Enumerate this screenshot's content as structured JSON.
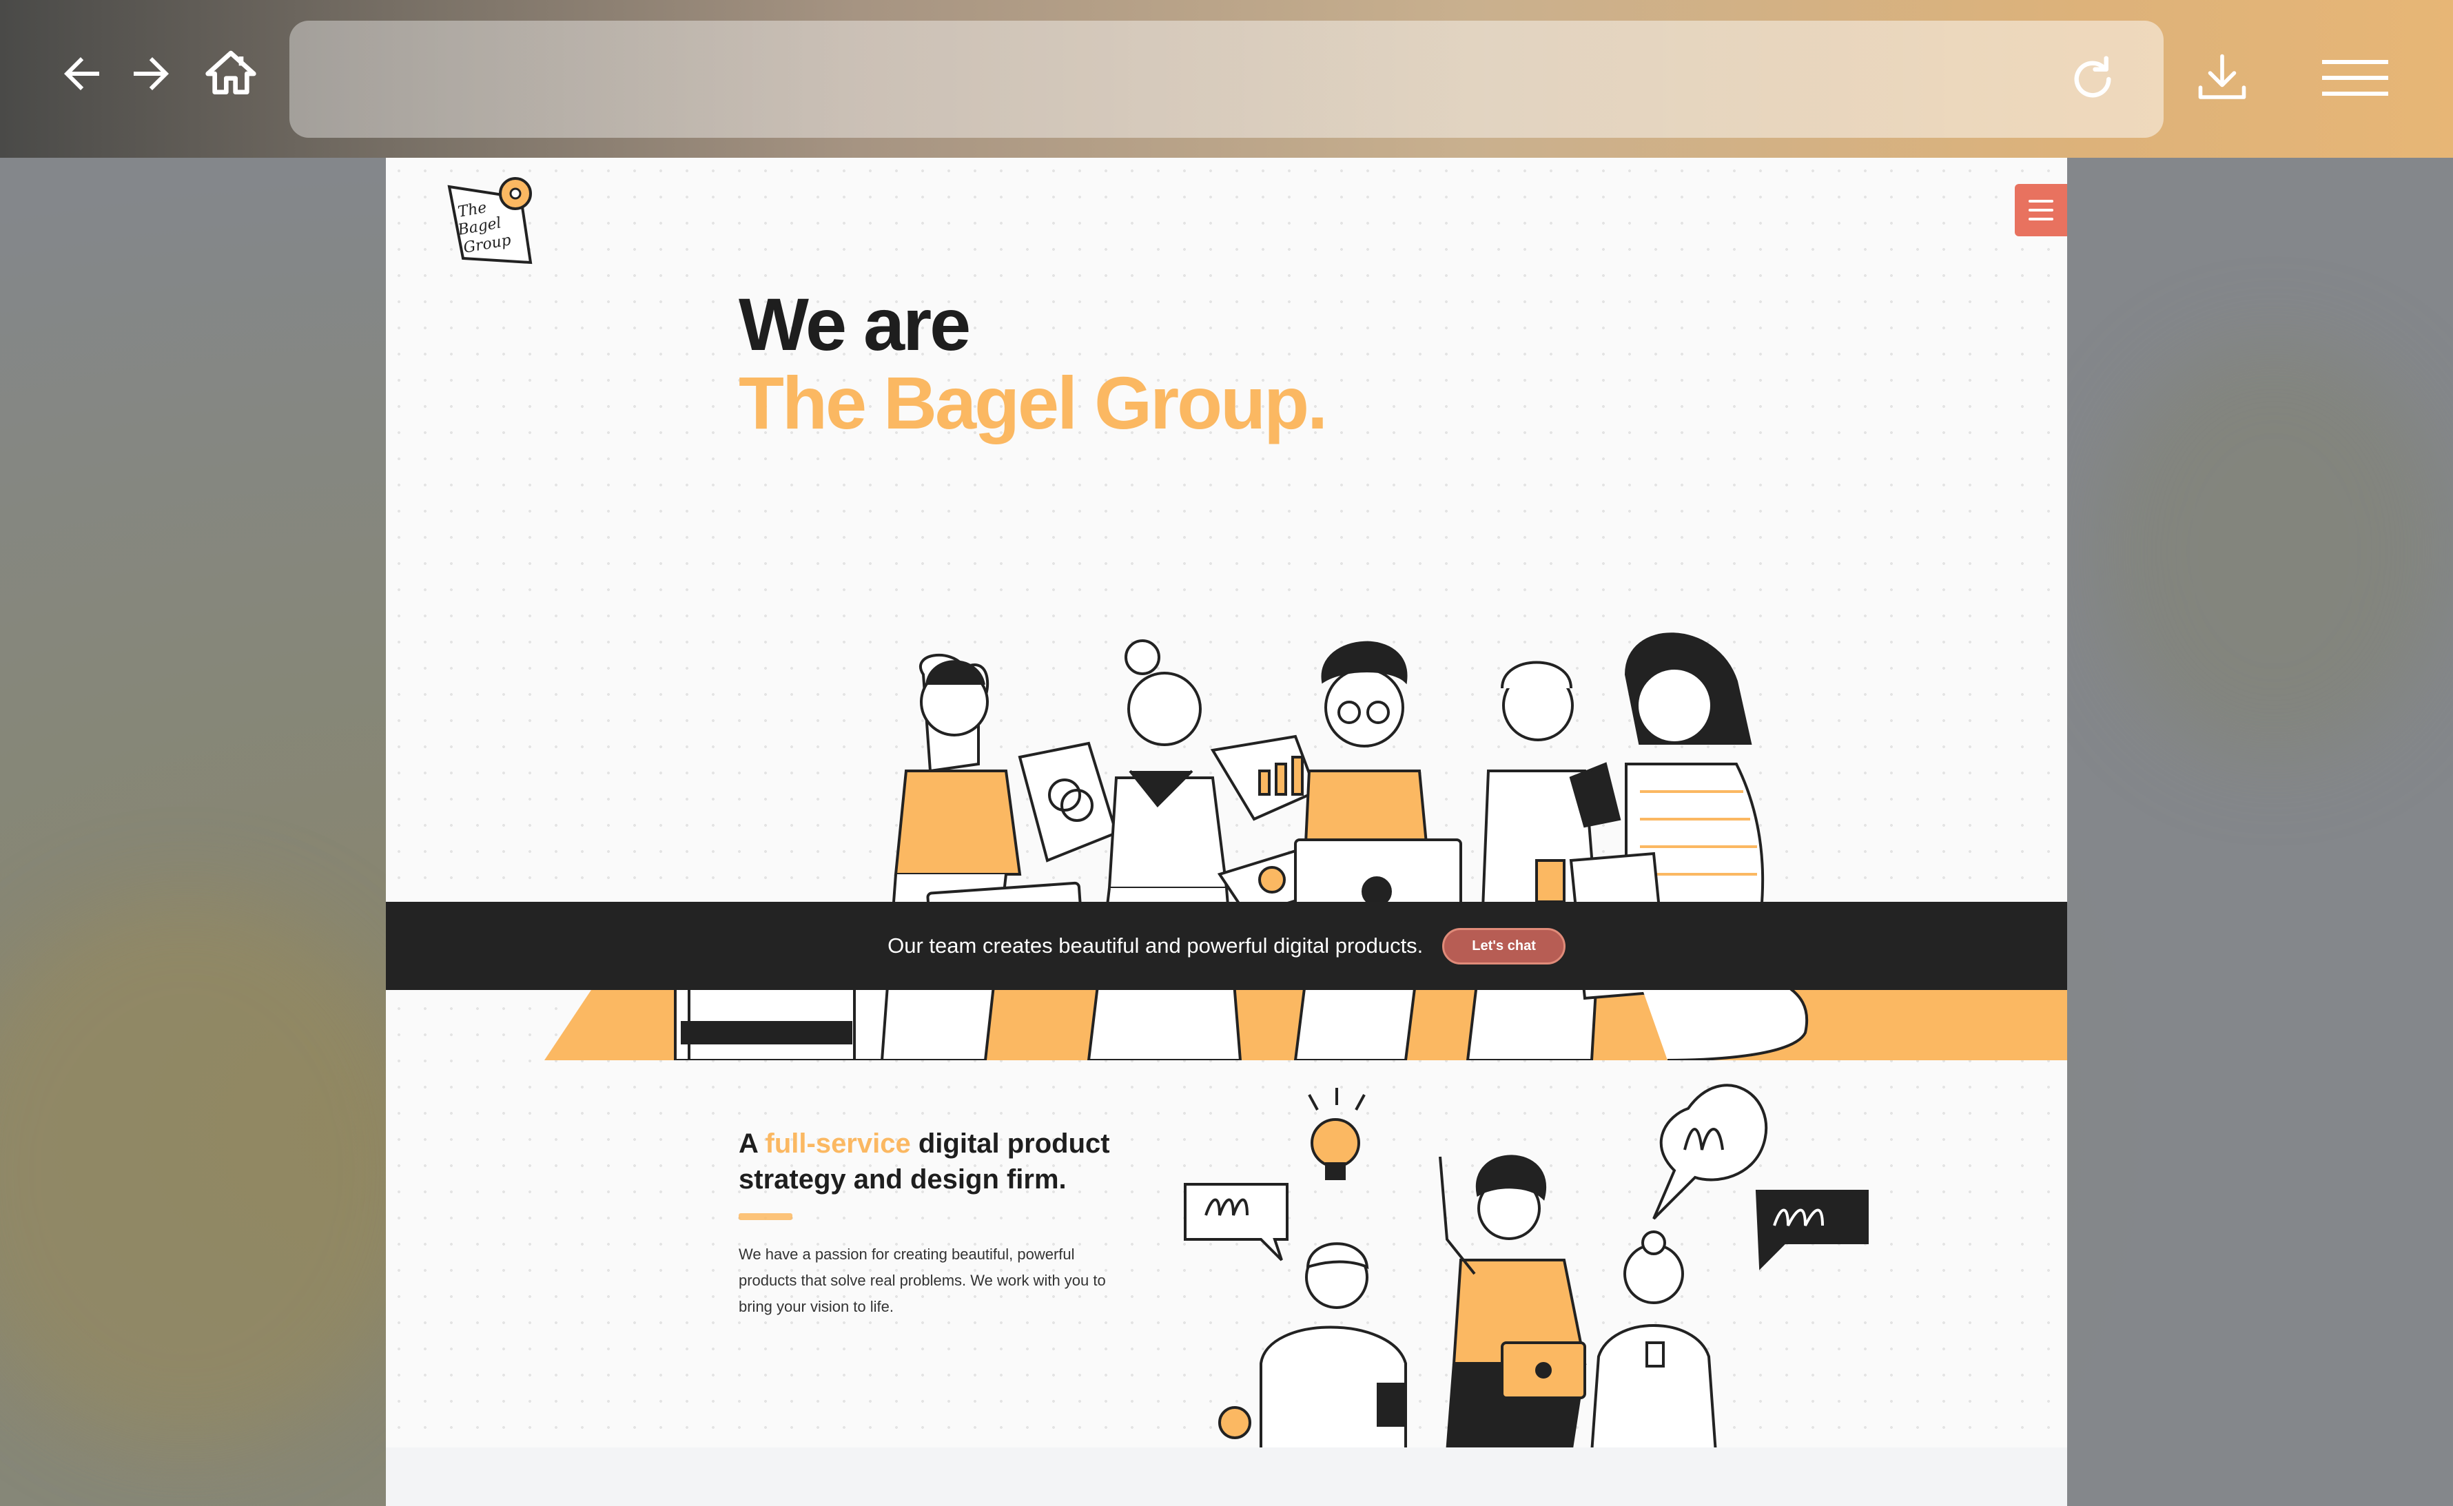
{
  "browser": {
    "back_icon": "arrow-left-icon",
    "forward_icon": "arrow-right-icon",
    "home_icon": "home-icon",
    "reload_icon": "reload-icon",
    "download_icon": "download-icon",
    "menu_icon": "hamburger-menu-icon",
    "url": ""
  },
  "site": {
    "logo_text": [
      "The",
      "Bagel",
      "Group"
    ],
    "menu_icon": "hamburger-menu-icon",
    "accent_color": "#fbb862",
    "button_color": "#b75d54"
  },
  "hero": {
    "title_line1": "We are",
    "title_line2": "The Bagel Group."
  },
  "banner": {
    "text": "Our team creates beautiful and powerful digital products.",
    "cta_label": "Let's chat"
  },
  "intro": {
    "title_prefix": "A ",
    "title_accent": "full-service",
    "title_suffix": " digital product strategy and design firm.",
    "body": "We have a passion for creating beautiful, powerful products that solve real problems. We work with you to bring your vision to life."
  }
}
